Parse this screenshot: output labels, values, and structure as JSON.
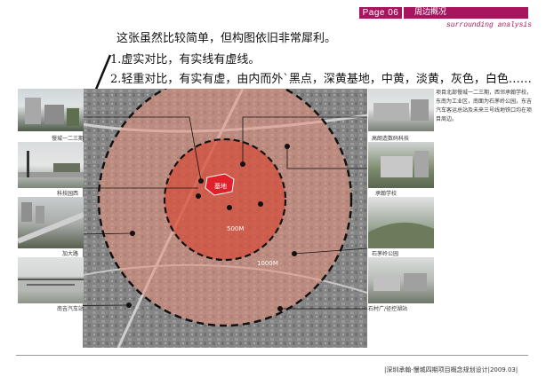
{
  "header": {
    "page": "Page 06",
    "section": "周边概况",
    "subtitle": "surrounding analysis"
  },
  "notes": {
    "line1": "这张虽然比较简单，但构图依旧非常犀利。",
    "line2": "1.虚实对比，有实线有虚线。",
    "line3": "2.轻重对比，有实有虚，由内而外`黑点，深黄基地，中黄，淡黄，灰色，白色……"
  },
  "map": {
    "site_label": "基地",
    "inner_ring_label": "500M",
    "outer_ring_label": "1000M"
  },
  "photos_left": [
    {
      "caption": "慢城一二三期"
    },
    {
      "caption": "科技园西"
    },
    {
      "caption": "加大路"
    },
    {
      "caption": "南吉汽车站"
    }
  ],
  "photos_right": [
    {
      "caption": "高朗造数码科技"
    },
    {
      "caption": "承翰学校"
    },
    {
      "caption": "石茅岭公园"
    },
    {
      "caption": "石村广/径控湖站"
    }
  ],
  "description": "项目北部慢城一二三期，西邻承翰学校，东南为工业区，南面为石茅岭公园，东吉汽车客运总站及未来三号线地铁口均在项目周边。",
  "footer": "|深圳承翰·慢城四期项目概念规划设计|2009.03|",
  "colors": {
    "accent": "#a8155f",
    "site": "#e0202a"
  }
}
